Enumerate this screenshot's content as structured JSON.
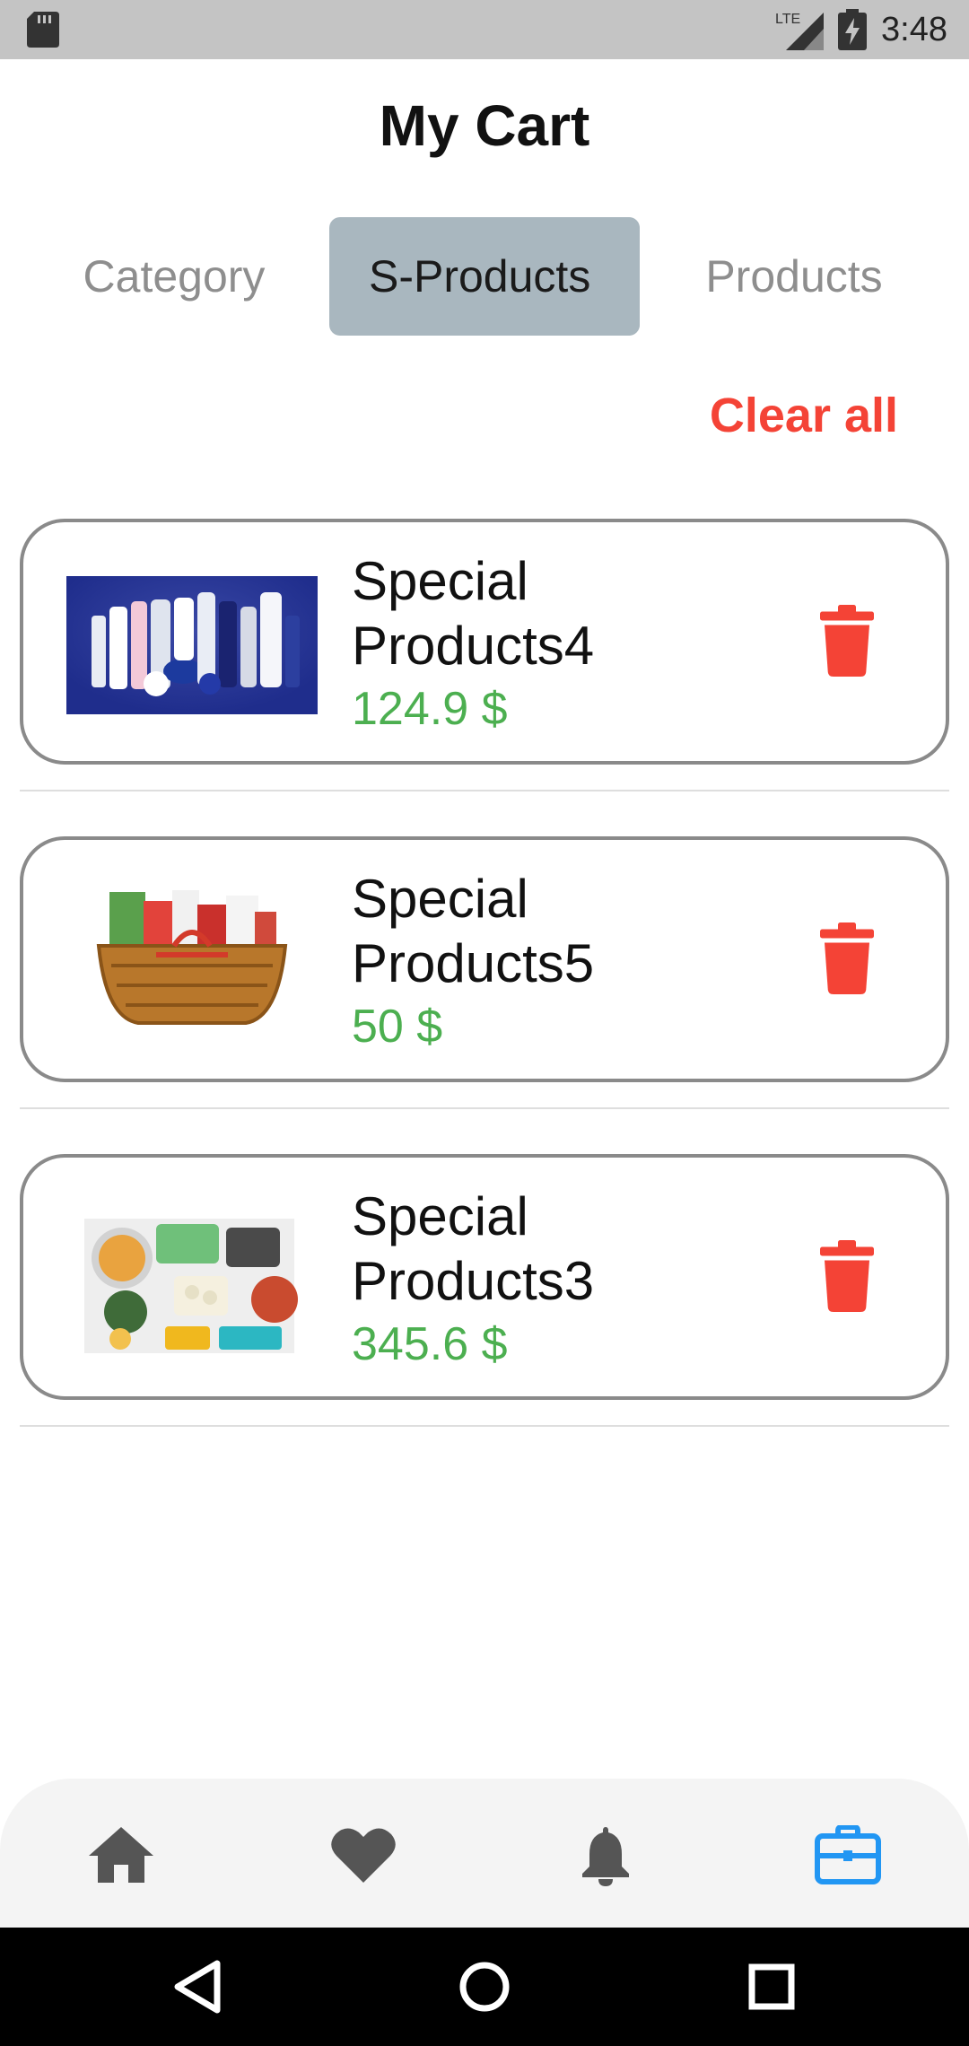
{
  "status_bar": {
    "network": "LTE",
    "time": "3:48"
  },
  "header": {
    "title": "My Cart"
  },
  "tabs": [
    {
      "label": "Category",
      "selected": false
    },
    {
      "label": "S-Products",
      "selected": true
    },
    {
      "label": "Products",
      "selected": false
    }
  ],
  "actions": {
    "clear_all_label": "Clear all"
  },
  "cart_items": [
    {
      "name": "Special Products4",
      "price": "124.9 $",
      "image": "cosmetics-product-photo"
    },
    {
      "name": "Special Products5",
      "price": "50 $",
      "image": "gift-basket-photo"
    },
    {
      "name": "Special Products3",
      "price": "345.6 $",
      "image": "food-products-photo"
    }
  ],
  "bottom_nav": {
    "items": [
      {
        "icon": "home-icon",
        "active": false
      },
      {
        "icon": "heart-icon",
        "active": false
      },
      {
        "icon": "bell-icon",
        "active": false
      },
      {
        "icon": "briefcase-icon",
        "active": true
      }
    ]
  },
  "colors": {
    "accent_red": "#f44336",
    "price_green": "#4caf50",
    "selected_tab_bg": "#a9b7bf",
    "active_nav_blue": "#2196f3",
    "inactive_nav": "#555555"
  }
}
